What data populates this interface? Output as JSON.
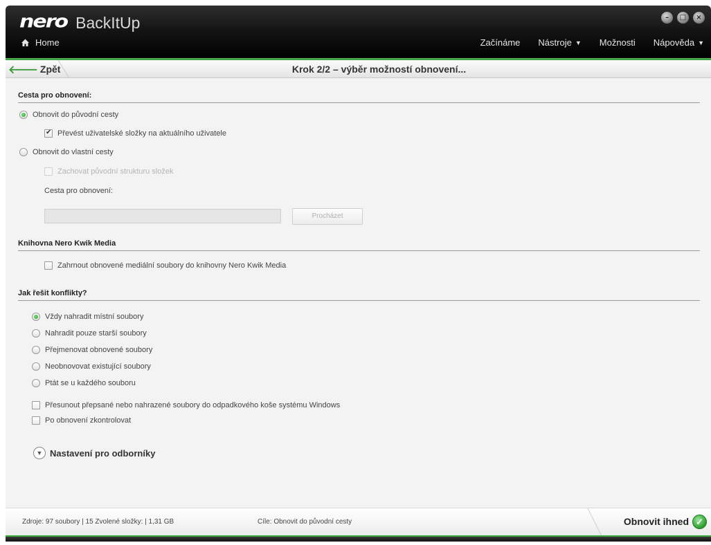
{
  "app": {
    "brand": "nero",
    "product": "BackItUp"
  },
  "header": {
    "home_label": "Home",
    "nav": [
      {
        "label": "Začínáme",
        "has_menu": false
      },
      {
        "label": "Nástroje",
        "has_menu": true
      },
      {
        "label": "Možnosti",
        "has_menu": false
      },
      {
        "label": "Nápověda",
        "has_menu": true
      }
    ],
    "window_controls": [
      "minimize-icon",
      "maximize-icon",
      "close-icon"
    ]
  },
  "stepbar": {
    "back_label": "Zpět",
    "title": "Krok 2/2 – výběr možností obnovení..."
  },
  "restore_path": {
    "heading": "Cesta pro obnovení:",
    "option_original": "Obnovit do původní cesty",
    "option_original_selected": true,
    "convert_user_folders": "Převést uživatelské složky na aktuálního uživatele",
    "convert_user_folders_checked": true,
    "option_custom": "Obnovit do vlastní cesty",
    "option_custom_selected": false,
    "keep_structure": "Zachovat původní strukturu složek",
    "keep_structure_checked": false,
    "path_label": "Cesta pro obnovení:",
    "path_value": "",
    "browse_label": "Procházet"
  },
  "media_library": {
    "heading": "Knihovna Nero Kwik Media",
    "include_label": "Zahrnout obnovené mediální soubory do knihovny Nero Kwik Media",
    "include_checked": false
  },
  "conflicts": {
    "heading": "Jak řešit konflikty?",
    "options": [
      {
        "label": "Vždy nahradit místní soubory",
        "selected": true
      },
      {
        "label": "Nahradit pouze starší soubory",
        "selected": false
      },
      {
        "label": "Přejmenovat obnovené soubory",
        "selected": false
      },
      {
        "label": "Neobnovovat existující soubory",
        "selected": false
      },
      {
        "label": "Ptát se u každého souboru",
        "selected": false
      }
    ],
    "move_to_recycle": "Přesunout přepsané nebo nahrazené soubory do odpadkového koše systému Windows",
    "move_to_recycle_checked": false,
    "verify_after": "Po obnovení zkontrolovat",
    "verify_after_checked": false
  },
  "expert": {
    "label": "Nastavení pro odborníky"
  },
  "footer": {
    "sources": "Zdroje: 97  soubory | 15 Zvolené složky: | 1,31 GB",
    "target": "Cíle: Obnovit do původní cesty",
    "action_label": "Obnovit ihned"
  },
  "colors": {
    "accent_green": "#3aa83a",
    "header_bg": "#111111",
    "content_bg": "#f3f3f3"
  }
}
